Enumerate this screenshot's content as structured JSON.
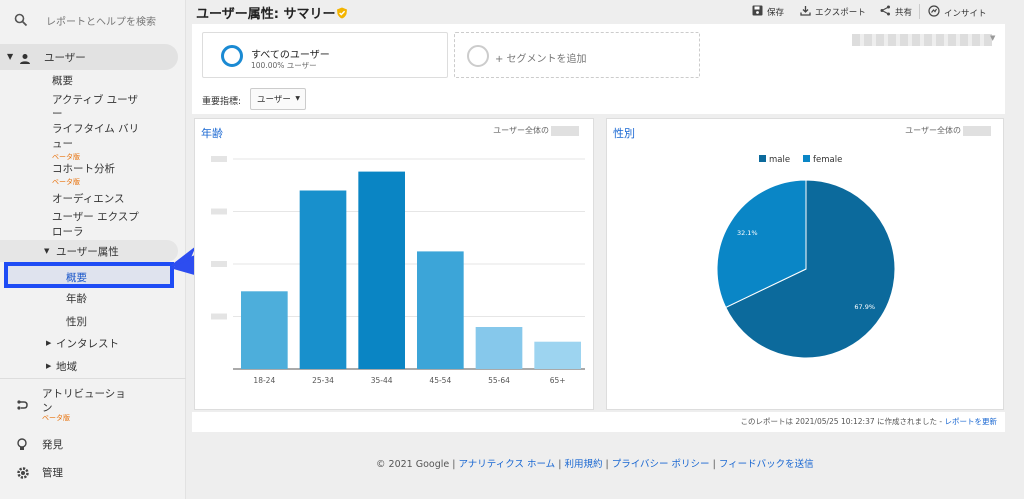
{
  "sidebar": {
    "search_placeholder": "レポートとヘルプを検索",
    "users_label": "ユーザー",
    "items": {
      "overview": "概要",
      "active_users_1": "アクティブ ユーザ",
      "active_users_2": "ー",
      "lifetime_1": "ライフタイム バリ",
      "lifetime_2": "ュー",
      "cohort": "コホート分析",
      "audience": "オーディエンス",
      "explorer_1": "ユーザー エクスプ",
      "explorer_2": "ローラ",
      "demographics": "ユーザー属性",
      "demo_overview": "概要",
      "age": "年齢",
      "gender": "性別",
      "interests": "インタレスト",
      "geo": "地域"
    },
    "beta_label": "ベータ版",
    "attribution_1": "アトリビューショ",
    "attribution_2": "ン",
    "discover": "発見",
    "admin": "管理"
  },
  "header": {
    "title": "ユーザー属性: サマリー",
    "save": "保存",
    "export": "エクスポート",
    "share": "共有",
    "insights": "インサイト"
  },
  "segments": {
    "all_users": "すべてのユーザー",
    "all_users_sub": "100.00% ユーザー",
    "add_segment": "+ セグメントを追加"
  },
  "metric": {
    "label": "重要指標:",
    "value": "ユーザー"
  },
  "age_card": {
    "title": "年齢",
    "note": "ユーザー全体の"
  },
  "gender_card": {
    "title": "性別",
    "note": "ユーザー全体の"
  },
  "chart_data": [
    {
      "type": "bar",
      "title": "年齢",
      "categories": [
        "18-24",
        "25-34",
        "35-44",
        "45-54",
        "55-64",
        "65+"
      ],
      "values": [
        0.37,
        0.85,
        0.94,
        0.56,
        0.2,
        0.13
      ],
      "colors": [
        "#4daedb",
        "#1890cc",
        "#0a85c4",
        "#3ca5d8",
        "#86c8eb",
        "#9dd4f0"
      ]
    },
    {
      "type": "pie",
      "title": "性別",
      "labels": [
        "male",
        "female"
      ],
      "values": [
        67.9,
        32.1
      ],
      "value_labels": [
        "67.9%",
        "32.1%"
      ],
      "colors": [
        "#0c6a9c",
        "#0a86c6"
      ],
      "legend": "top"
    }
  ],
  "footer": {
    "created": "このレポートは 2021/05/25 10:12:37 に作成されました -",
    "refresh": "レポートを更新",
    "copyright": "© 2021 Google |",
    "link1": "アナリティクス ホーム",
    "link2": "利用規約",
    "link3": "プライバシー ポリシー",
    "link4": "フィードバックを送信",
    "sep": "|"
  }
}
